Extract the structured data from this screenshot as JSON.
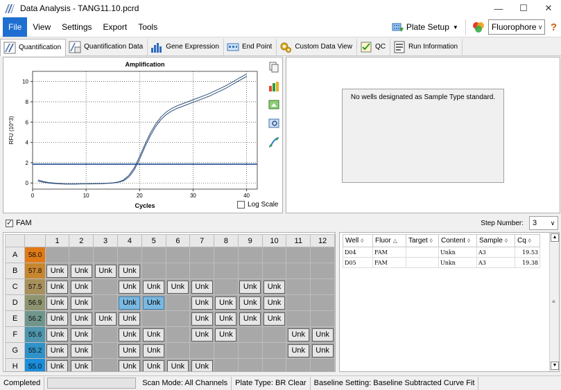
{
  "window": {
    "title": "Data Analysis - TANG11.10.pcrd"
  },
  "menu": {
    "items": [
      "File",
      "View",
      "Settings",
      "Export",
      "Tools"
    ]
  },
  "toolbar": {
    "plate_setup": "Plate Setup",
    "fluorophore": "Fluorophore",
    "help": "?"
  },
  "tabs": [
    "Quantification",
    "Quantification Data",
    "Gene Expression",
    "End Point",
    "Custom Data View",
    "QC",
    "Run Information"
  ],
  "chart_data": {
    "type": "line",
    "title": "Amplification",
    "xlabel": "Cycles",
    "ylabel": "RFU (10^3)",
    "xlim": [
      0,
      42
    ],
    "ylim": [
      -0.6,
      11
    ],
    "xticks": [
      0,
      10,
      20,
      30,
      40
    ],
    "yticks": [
      0,
      2,
      4,
      6,
      8,
      10
    ],
    "grid": true,
    "threshold": 1.85,
    "x": [
      1,
      2,
      3,
      4,
      5,
      6,
      7,
      8,
      9,
      10,
      11,
      12,
      13,
      14,
      15,
      16,
      17,
      18,
      19,
      20,
      21,
      22,
      23,
      24,
      25,
      26,
      27,
      28,
      29,
      30,
      31,
      32,
      33,
      34,
      35,
      36,
      37,
      38,
      39,
      40
    ],
    "series": [
      {
        "values": [
          0.3,
          0.15,
          0.05,
          0.0,
          -0.05,
          -0.08,
          -0.08,
          -0.08,
          -0.07,
          -0.07,
          -0.06,
          -0.05,
          -0.04,
          -0.02,
          0.02,
          0.1,
          0.3,
          0.75,
          1.5,
          2.6,
          3.8,
          4.9,
          5.8,
          6.5,
          7.0,
          7.35,
          7.6,
          7.8,
          8.0,
          8.2,
          8.4,
          8.6,
          8.8,
          9.05,
          9.3,
          9.55,
          9.85,
          10.15,
          10.45,
          10.75
        ]
      },
      {
        "values": [
          0.2,
          0.08,
          0.0,
          -0.05,
          -0.08,
          -0.1,
          -0.1,
          -0.1,
          -0.09,
          -0.09,
          -0.08,
          -0.07,
          -0.06,
          -0.04,
          0.0,
          0.06,
          0.22,
          0.6,
          1.3,
          2.35,
          3.55,
          4.65,
          5.55,
          6.25,
          6.75,
          7.1,
          7.35,
          7.55,
          7.75,
          7.95,
          8.15,
          8.35,
          8.55,
          8.8,
          9.05,
          9.3,
          9.6,
          9.9,
          10.2,
          10.5
        ]
      }
    ]
  },
  "chart_options": {
    "log_scale": "Log Scale"
  },
  "standard_panel": {
    "message": "No wells designated as Sample Type standard."
  },
  "fluor_filter": {
    "label": "FAM",
    "checked": true
  },
  "step": {
    "label": "Step Number:",
    "value": "3"
  },
  "plate": {
    "columns": [
      "1",
      "2",
      "3",
      "4",
      "5",
      "6",
      "7",
      "8",
      "9",
      "10",
      "11",
      "12"
    ],
    "rows": [
      {
        "label": "A",
        "temp": "58.0",
        "color": "#e07a16",
        "wells": [
          "",
          "",
          "",
          "",
          "",
          "",
          "",
          "",
          "",
          "",
          "",
          ""
        ]
      },
      {
        "label": "B",
        "temp": "57.8",
        "color": "#c8862e",
        "wells": [
          "Unk",
          "Unk",
          "Unk",
          "Unk",
          "",
          "",
          "",
          "",
          "",
          "",
          "",
          ""
        ]
      },
      {
        "label": "C",
        "temp": "57.5",
        "color": "#a8905a",
        "wells": [
          "Unk",
          "Unk",
          "",
          "Unk",
          "Unk",
          "Unk",
          "Unk",
          "",
          "Unk",
          "Unk",
          "",
          ""
        ]
      },
      {
        "label": "D",
        "temp": "56.9",
        "color": "#8e9470",
        "wells": [
          "Unk",
          "Unk",
          "",
          "Unk*",
          "Unk*",
          "",
          "Unk",
          "Unk",
          "Unk",
          "Unk",
          "",
          ""
        ]
      },
      {
        "label": "E",
        "temp": "56.2",
        "color": "#70968c",
        "wells": [
          "Unk",
          "Unk",
          "Unk",
          "Unk",
          "",
          "",
          "Unk",
          "Unk",
          "Unk",
          "Unk",
          "",
          ""
        ]
      },
      {
        "label": "F",
        "temp": "55.6",
        "color": "#4e96ae",
        "wells": [
          "Unk",
          "Unk",
          "",
          "Unk",
          "Unk",
          "",
          "Unk",
          "Unk",
          "",
          "",
          "Unk",
          "Unk"
        ]
      },
      {
        "label": "G",
        "temp": "55.2",
        "color": "#2f92c8",
        "wells": [
          "Unk",
          "Unk",
          "",
          "Unk",
          "Unk",
          "",
          "",
          "",
          "",
          "",
          "Unk",
          "Unk"
        ]
      },
      {
        "label": "H",
        "temp": "55.0",
        "color": "#1a8edc",
        "wells": [
          "Unk",
          "Unk",
          "",
          "Unk",
          "Unk",
          "Unk",
          "Unk",
          "",
          "",
          "",
          "",
          ""
        ]
      }
    ]
  },
  "well_table": {
    "headers": [
      "Well",
      "Fluor",
      "Target",
      "Content",
      "Sample",
      "Cq"
    ],
    "rows": [
      [
        "D04",
        "FAM",
        "",
        "Unkn",
        "A3",
        "19.53"
      ],
      [
        "D05",
        "FAM",
        "",
        "Unkn",
        "A3",
        "19.38"
      ]
    ]
  },
  "status": {
    "state": "Completed",
    "scan_mode": "Scan Mode: All Channels",
    "plate_type": "Plate Type: BR Clear",
    "baseline": "Baseline Setting: Baseline Subtracted Curve Fit"
  },
  "colors": {
    "accent": "#1e6fd1",
    "curve": "#2b4e7a",
    "threshold": "#1f4f9a",
    "well_empty": "#a8a8a8",
    "well_selected": "#7ab8e0"
  }
}
